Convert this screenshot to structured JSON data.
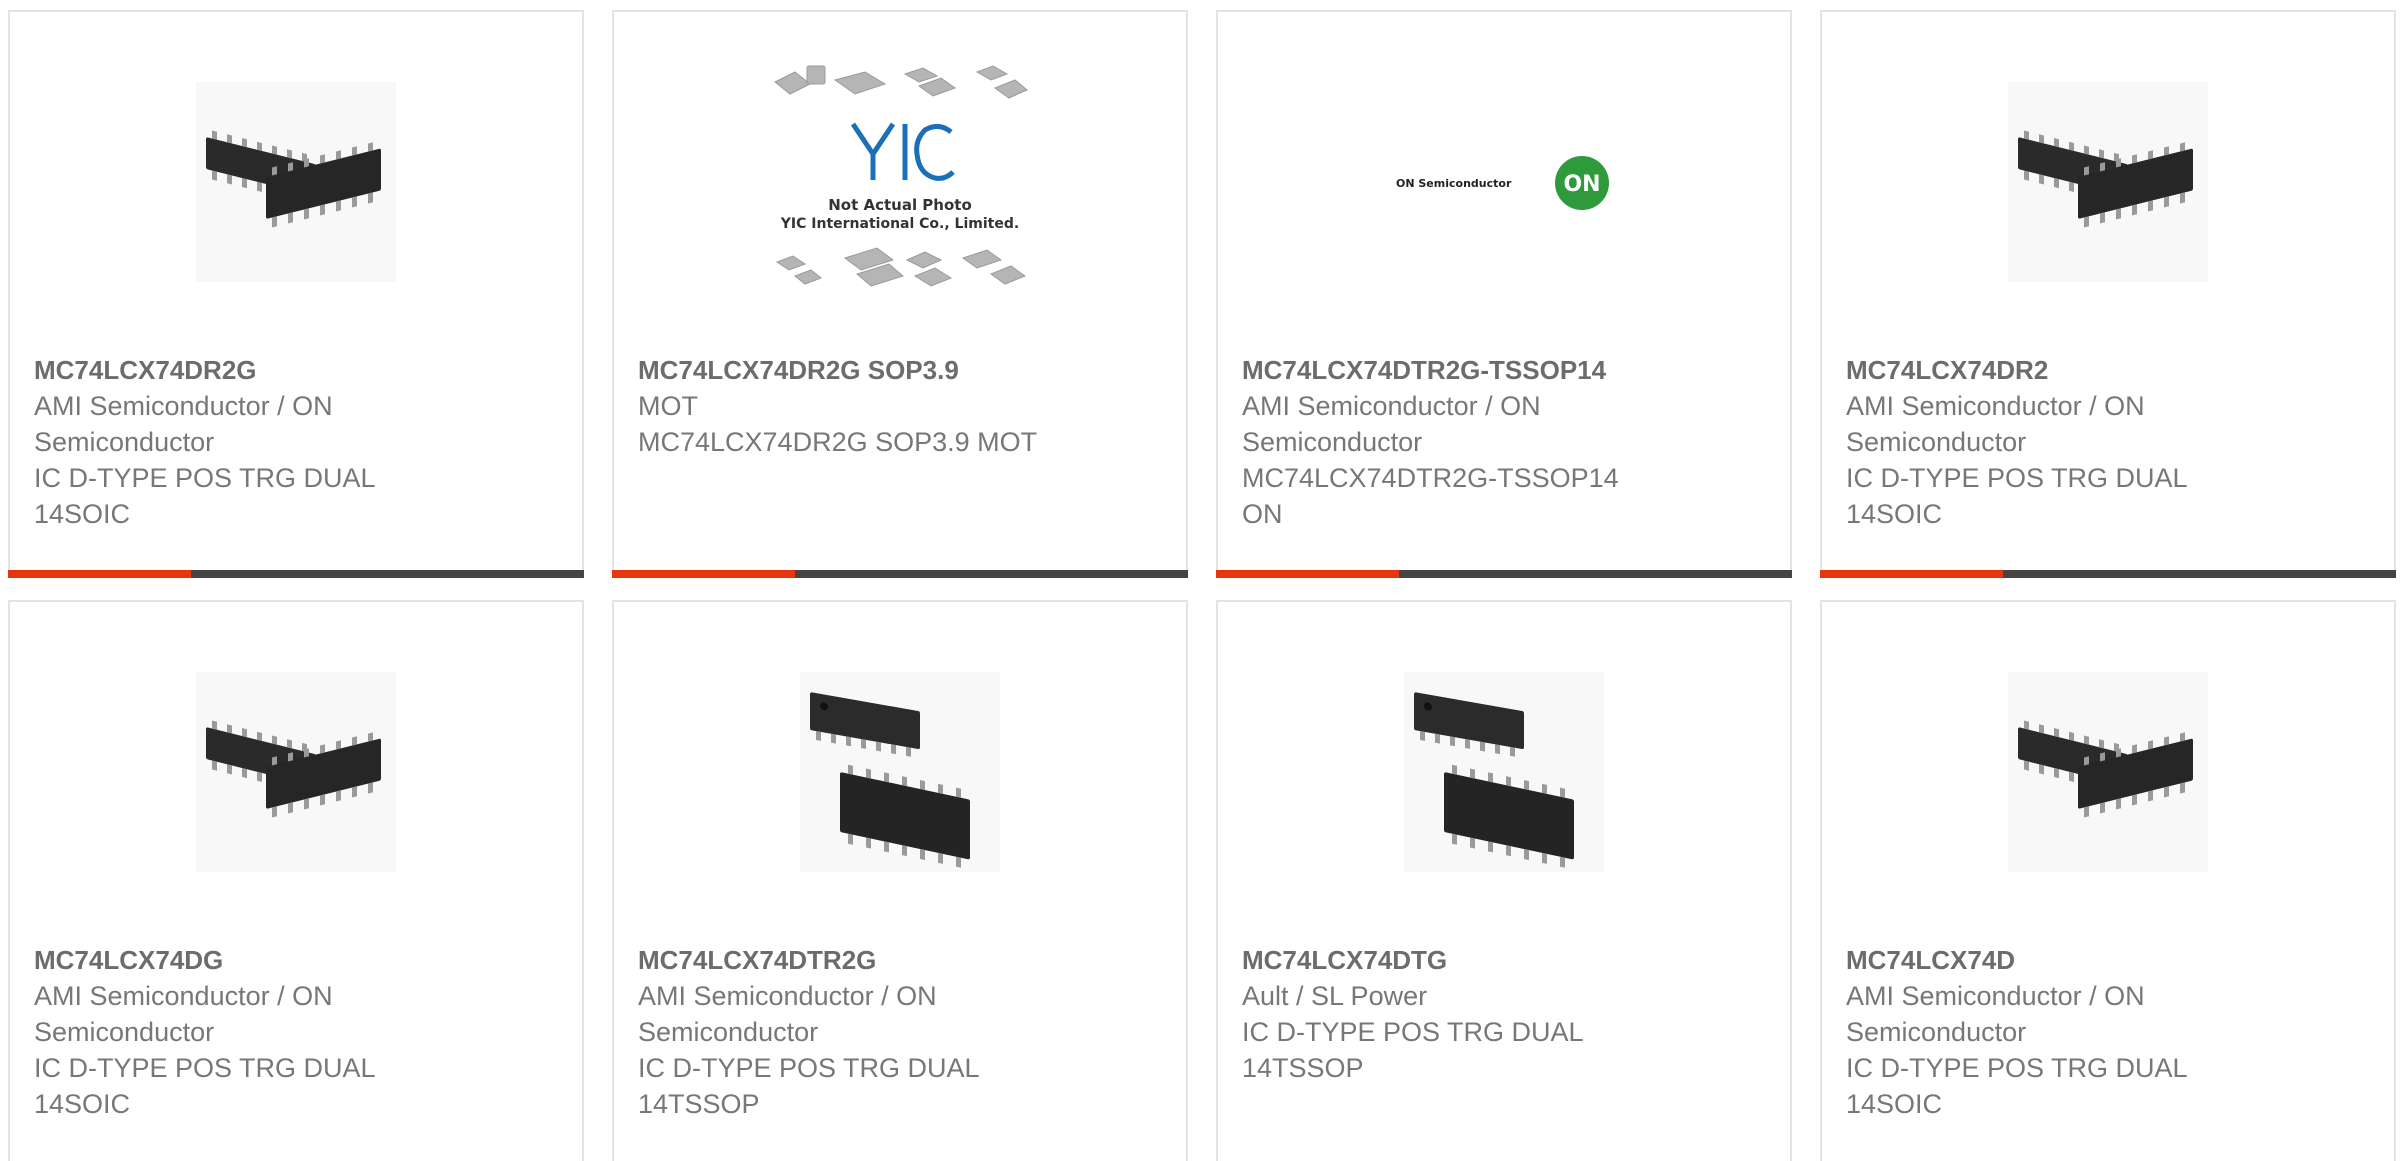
{
  "colors": {
    "accent": "#e8350f",
    "bar": "#454545",
    "title": "#6c6c6c",
    "text": "#777777",
    "on_logo_green": "#2f9a3c",
    "yic_blue": "#1b6fb8"
  },
  "cards": [
    {
      "title": "MC74LCX74DR2G",
      "manufacturer": "AMI Semiconductor / ON Semiconductor",
      "description": "IC D-TYPE POS TRG DUAL 14SOIC",
      "image": "soic14-chip-image",
      "active_bar": true
    },
    {
      "title": "MC74LCX74DR2G SOP3.9",
      "manufacturer": "MOT",
      "description": "MC74LCX74DR2G SOP3.9 MOT",
      "image": "yic-placeholder-image",
      "placeholder_line1": "Not Actual Photo",
      "placeholder_line2": "YIC International Co., Limited.",
      "placeholder_logo": "YIC",
      "active_bar": true
    },
    {
      "title": "MC74LCX74DTR2G-TSSOP14",
      "manufacturer": "AMI Semiconductor / ON Semiconductor",
      "description": "MC74LCX74DTR2G-TSSOP14 ON",
      "image": "on-semiconductor-logo",
      "logo_text": "ON Semiconductor",
      "logo_mark": "ON",
      "active_bar": true
    },
    {
      "title": "MC74LCX74DR2",
      "manufacturer": "AMI Semiconductor / ON Semiconductor",
      "description": "IC D-TYPE POS TRG DUAL 14SOIC",
      "image": "soic14-chip-image",
      "active_bar": true
    },
    {
      "title": "MC74LCX74DG",
      "manufacturer": "AMI Semiconductor / ON Semiconductor",
      "description": "IC D-TYPE POS TRG DUAL 14SOIC",
      "image": "soic14-chip-image",
      "active_bar": false
    },
    {
      "title": "MC74LCX74DTR2G",
      "manufacturer": "AMI Semiconductor / ON Semiconductor",
      "description": "IC D-TYPE POS TRG DUAL 14TSSOP",
      "image": "tssop14-chip-image",
      "active_bar": false
    },
    {
      "title": "MC74LCX74DTG",
      "manufacturer": "Ault / SL Power",
      "description": "IC D-TYPE POS TRG DUAL 14TSSOP",
      "image": "tssop14-chip-image",
      "active_bar": false
    },
    {
      "title": "MC74LCX74D",
      "manufacturer": "AMI Semiconductor / ON Semiconductor",
      "description": "IC D-TYPE POS TRG DUAL 14SOIC",
      "image": "soic14-chip-image",
      "active_bar": false
    }
  ]
}
